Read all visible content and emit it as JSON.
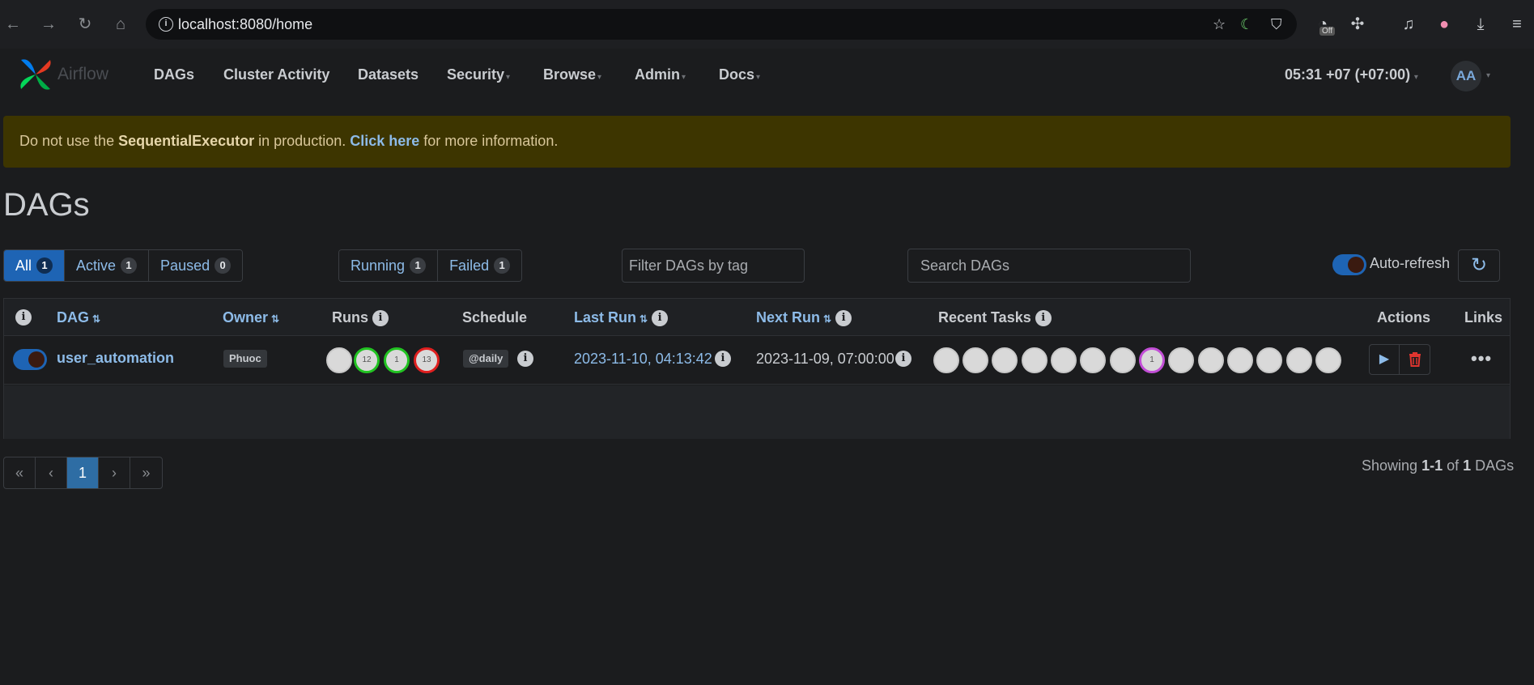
{
  "browser": {
    "url": "localhost:8080/home",
    "back_icon": "arrow-left-icon",
    "forward_icon": "arrow-right-icon",
    "reload_icon": "reload-icon",
    "home_icon": "home-icon",
    "ext_badge": "Off"
  },
  "nav": {
    "brand": "Airflow",
    "items": [
      "DAGs",
      "Cluster Activity",
      "Datasets",
      "Security",
      "Browse",
      "Admin",
      "Docs"
    ],
    "clock": "05:31 +07 (+07:00)",
    "user_initials": "AA"
  },
  "alert": {
    "pre": "Do not use the ",
    "strong": "SequentialExecutor",
    "mid": " in production. ",
    "link": "Click here",
    "post": " for more information."
  },
  "page": {
    "title": "DAGs"
  },
  "filters": {
    "status": [
      {
        "label": "All",
        "count": "1"
      },
      {
        "label": "Active",
        "count": "1"
      },
      {
        "label": "Paused",
        "count": "0"
      }
    ],
    "run_state": [
      {
        "label": "Running",
        "count": "1"
      },
      {
        "label": "Failed",
        "count": "1"
      }
    ],
    "tag_placeholder": "Filter DAGs by tag",
    "search_placeholder": "Search DAGs",
    "auto_refresh": "Auto-refresh"
  },
  "table": {
    "headers": {
      "dag": "DAG",
      "owner": "Owner",
      "runs": "Runs",
      "schedule": "Schedule",
      "last_run": "Last Run",
      "next_run": "Next Run",
      "recent_tasks": "Recent Tasks",
      "actions": "Actions",
      "links": "Links"
    },
    "row": {
      "dag_id": "user_automation",
      "owner": "Phuoc",
      "runs": [
        "",
        "12",
        "1",
        "13"
      ],
      "schedule": "@daily",
      "last_run": "2023-11-10, 04:13:42",
      "next_run": "2023-11-09, 07:00:00",
      "recent_tasks": [
        "",
        "",
        "",
        "",
        "",
        "",
        "",
        "1",
        "",
        "",
        "",
        "",
        "",
        ""
      ]
    }
  },
  "pagination": {
    "first": "«",
    "prev": "‹",
    "current": "1",
    "next": "›",
    "last": "»"
  },
  "footer": {
    "showing_pre": "Showing ",
    "range": "1-1",
    "of": " of ",
    "total": "1",
    "suffix": " DAGs"
  }
}
